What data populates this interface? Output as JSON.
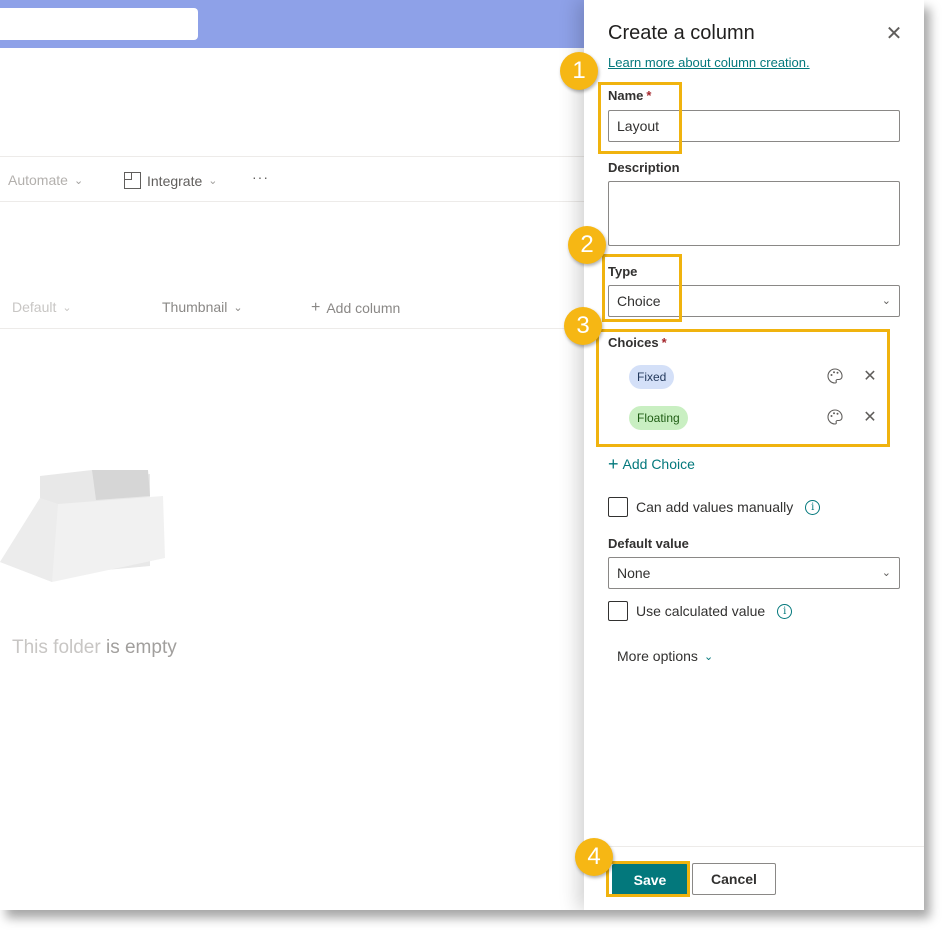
{
  "background": {
    "commands": {
      "automate": "Automate",
      "integrate": "Integrate",
      "more": "···"
    },
    "columns": {
      "default": "Default",
      "thumbnail": "Thumbnail",
      "add_column": "Add column"
    },
    "empty_state": {
      "text_part1": "This folder",
      "text_part2": " is empty"
    }
  },
  "panel": {
    "title": "Create a column",
    "learn_more_link": "Learn more about column creation.",
    "name_label": "Name",
    "required_mark": "*",
    "name_value": "Layout",
    "description_label": "Description",
    "description_value": "",
    "type_label": "Type",
    "type_value": "Choice",
    "choices_label": "Choices",
    "choices": [
      {
        "label": "Fixed",
        "color": "#d4e0f8"
      },
      {
        "label": "Floating",
        "color": "#c9efc2"
      }
    ],
    "add_choice": "Add Choice",
    "can_add_manually": "Can add values manually",
    "default_value_label": "Default value",
    "default_value": "None",
    "use_calculated": "Use calculated value",
    "more_options": "More options",
    "save_label": "Save",
    "cancel_label": "Cancel"
  },
  "annotations": {
    "markers": [
      "1",
      "2",
      "3",
      "4"
    ],
    "highlight_color": "#f0b30e"
  },
  "colors": {
    "accent": "#03787c",
    "topbar": "#8ea1e8"
  },
  "icons": {
    "close": "close-icon",
    "chevron": "chevron-down-icon",
    "palette": "palette-icon",
    "remove": "remove-choice-icon",
    "info": "info-icon",
    "folder": "folder-icon"
  }
}
